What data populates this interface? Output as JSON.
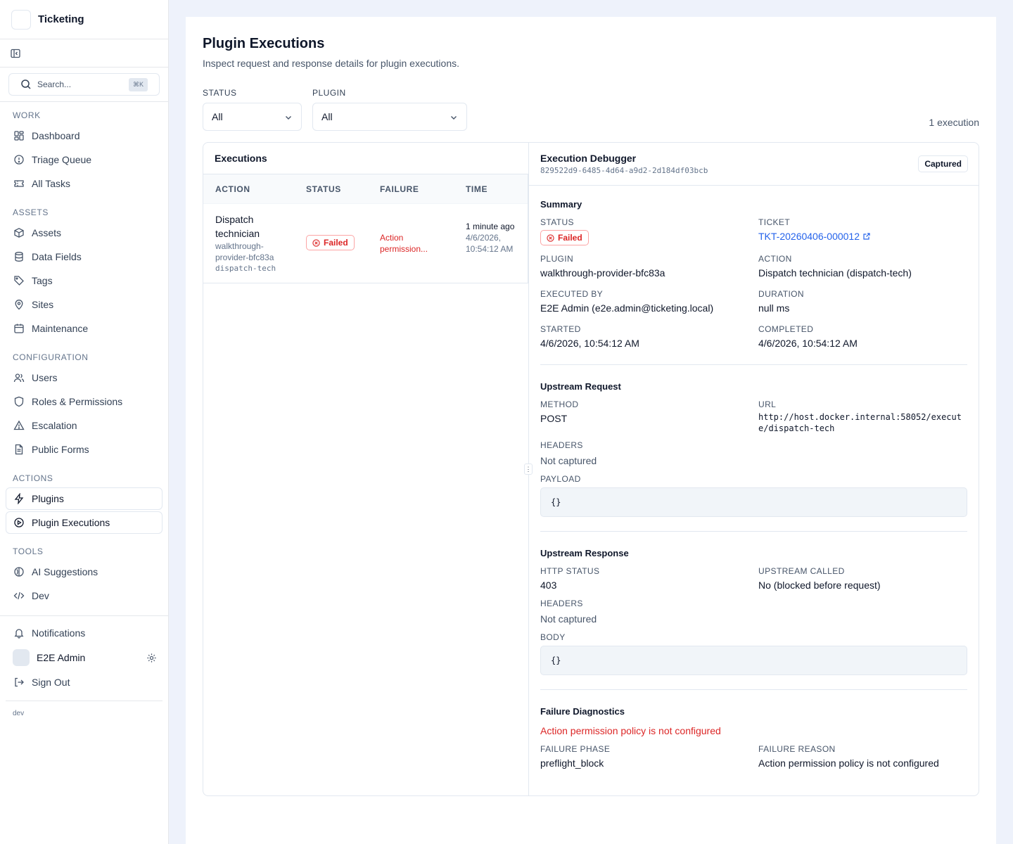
{
  "app": {
    "name": "Ticketing"
  },
  "search": {
    "placeholder": "Search...",
    "shortcut": "⌘K"
  },
  "sidebar": {
    "sections": {
      "work": "WORK",
      "assets": "ASSETS",
      "configuration": "CONFIGURATION",
      "actions": "ACTIONS",
      "tools": "TOOLS"
    },
    "items": {
      "dashboard": "Dashboard",
      "triage": "Triage Queue",
      "all_tasks": "All Tasks",
      "assets": "Assets",
      "data_fields": "Data Fields",
      "tags": "Tags",
      "sites": "Sites",
      "maintenance": "Maintenance",
      "users": "Users",
      "roles": "Roles & Permissions",
      "escalation": "Escalation",
      "public_forms": "Public Forms",
      "plugins": "Plugins",
      "plugin_executions": "Plugin Executions",
      "ai_suggestions": "AI Suggestions",
      "dev": "Dev",
      "notifications": "Notifications",
      "sign_out": "Sign Out"
    },
    "user": {
      "name": "E2E Admin"
    },
    "env": "dev"
  },
  "page": {
    "title": "Plugin Executions",
    "subtitle": "Inspect request and response details for plugin executions.",
    "filters": {
      "status_label": "STATUS",
      "status_value": "All",
      "plugin_label": "PLUGIN",
      "plugin_value": "All"
    },
    "count": "1 execution"
  },
  "executions": {
    "title": "Executions",
    "columns": [
      "ACTION",
      "STATUS",
      "FAILURE",
      "TIME"
    ],
    "rows": [
      {
        "action": "Dispatch technician",
        "plugin": "walkthrough-provider-bfc83a",
        "action_key": "dispatch-tech",
        "status": "Failed",
        "failure": "Action permission...",
        "time_relative": "1 minute ago",
        "time_absolute": "4/6/2026, 10:54:12 AM"
      }
    ]
  },
  "debugger": {
    "title": "Execution Debugger",
    "id": "829522d9-6485-4d64-a9d2-2d184df03bcb",
    "badge": "Captured",
    "summary": {
      "title": "Summary",
      "status_label": "STATUS",
      "status": "Failed",
      "ticket_label": "TICKET",
      "ticket": "TKT-20260406-000012",
      "plugin_label": "PLUGIN",
      "plugin": "walkthrough-provider-bfc83a",
      "action_label": "ACTION",
      "action": "Dispatch technician (dispatch-tech)",
      "executed_by_label": "EXECUTED BY",
      "executed_by": "E2E Admin (e2e.admin@ticketing.local)",
      "duration_label": "DURATION",
      "duration": "null ms",
      "started_label": "STARTED",
      "started": "4/6/2026, 10:54:12 AM",
      "completed_label": "COMPLETED",
      "completed": "4/6/2026, 10:54:12 AM"
    },
    "request": {
      "title": "Upstream Request",
      "method_label": "METHOD",
      "method": "POST",
      "url_label": "URL",
      "url": "http://host.docker.internal:58052/execute/dispatch-tech",
      "headers_label": "HEADERS",
      "headers": "Not captured",
      "payload_label": "PAYLOAD",
      "payload": "{}"
    },
    "response": {
      "title": "Upstream Response",
      "http_status_label": "HTTP STATUS",
      "http_status": "403",
      "upstream_called_label": "UPSTREAM CALLED",
      "upstream_called": "No (blocked before request)",
      "headers_label": "HEADERS",
      "headers": "Not captured",
      "body_label": "BODY",
      "body": "{}"
    },
    "diagnostics": {
      "title": "Failure Diagnostics",
      "message": "Action permission policy is not configured",
      "phase_label": "FAILURE PHASE",
      "phase": "preflight_block",
      "reason_label": "FAILURE REASON",
      "reason": "Action permission policy is not configured"
    }
  },
  "colors": {
    "accent": "#2563eb",
    "danger": "#dc2626",
    "background": "#eef2fb"
  }
}
